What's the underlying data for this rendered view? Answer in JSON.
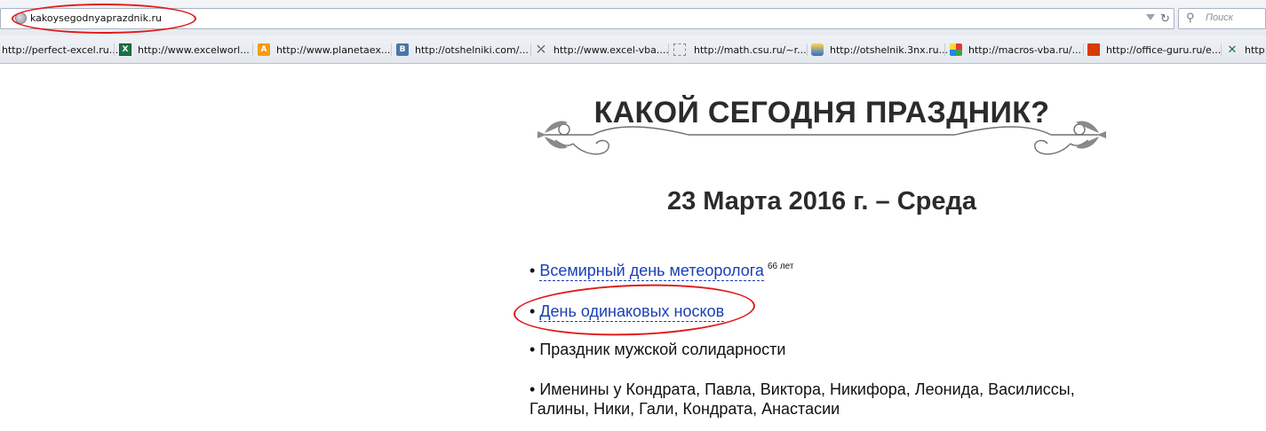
{
  "browser": {
    "url": "kakoysegodnyaprazdnik.ru",
    "search_placeholder": "Поиск"
  },
  "bookmarks": [
    {
      "label": "http://perfect-excel.ru...",
      "icon": "none",
      "color": "#ffffff"
    },
    {
      "label": "http://www.excelworl...",
      "icon": "excel-icon",
      "color": "#1e7145"
    },
    {
      "label": "http://www.planetaex...",
      "icon": "planeta-icon",
      "color": "#f39c12"
    },
    {
      "label": "http://otshelniki.com/...",
      "icon": "vk-icon",
      "color": "#4a76a8"
    },
    {
      "label": "http://www.excel-vba....",
      "icon": "excel-vba-icon",
      "color": "#3b3b3b"
    },
    {
      "label": "http://math.csu.ru/~r...",
      "icon": "blank-page-icon",
      "color": "#ffffff"
    },
    {
      "label": "http://otshelnik.3nx.ru...",
      "icon": "bird-icon",
      "color": "#2b6fd6"
    },
    {
      "label": "http://macros-vba.ru/...",
      "icon": "puzzle-icon",
      "color": "#6a3fb0"
    },
    {
      "label": "http://office-guru.ru/e...",
      "icon": "office-icon",
      "color": "#d83b01"
    },
    {
      "label": "http://",
      "icon": "excel-x-icon",
      "color": "#1e7145"
    }
  ],
  "page": {
    "title": "КАКОЙ СЕГОДНЯ ПРАЗДНИК?",
    "date": "23 Марта 2016 г. – Среда",
    "bullet": "•",
    "holidays": [
      {
        "text": "Всемирный день метеоролога",
        "badge": "66 лет",
        "link": true
      },
      {
        "text": "День одинаковых носков",
        "link": true
      },
      {
        "text": "Праздник мужской солидарности",
        "link": false
      },
      {
        "text": "Именины у Кондрата, Павла, Виктора, Никифора, Леонида, Василиссы,",
        "link": false
      },
      {
        "text": "Галины, Ники, Гали, Кондрата, Анастасии",
        "link": false
      }
    ]
  },
  "colors": {
    "annotation": "#e01a1a",
    "link": "#1a3fb4",
    "heading": "#2b2b2b"
  }
}
